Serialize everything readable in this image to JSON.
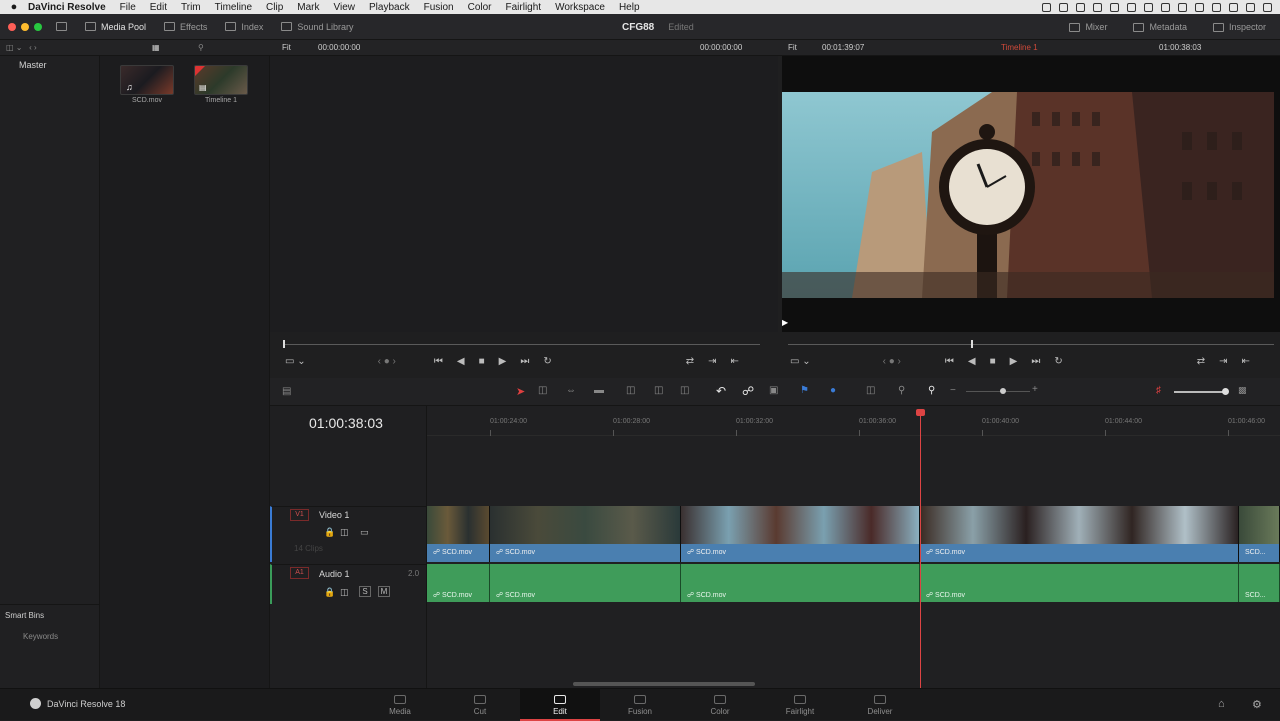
{
  "menubar": {
    "apple": "",
    "app": "DaVinci Resolve",
    "items": [
      "File",
      "Edit",
      "Trim",
      "Timeline",
      "Clip",
      "Mark",
      "View",
      "Playback",
      "Fusion",
      "Color",
      "Fairlight",
      "Workspace",
      "Help"
    ]
  },
  "toolbar": {
    "media_pool": "Media Pool",
    "effects": "Effects",
    "index": "Index",
    "sound_library": "Sound Library",
    "project": "CFG88",
    "edited": "Edited",
    "mixer": "Mixer",
    "metadata": "Metadata",
    "inspector": "Inspector"
  },
  "source_bar": {
    "fit": "Fit",
    "tc_left": "00:00:00:00",
    "tc_right": "00:00:00:00"
  },
  "program_bar": {
    "fit": "Fit",
    "duration": "00:01:39:07",
    "timeline_name": "Timeline 1",
    "timecode": "01:00:38:03"
  },
  "bins": {
    "master": "Master",
    "smart_bins": "Smart Bins",
    "keywords": "Keywords"
  },
  "pool_clips": [
    {
      "label": "SCD.mov"
    },
    {
      "label": "Timeline 1"
    }
  ],
  "timeline": {
    "timecode": "01:00:38:03",
    "ruler": [
      "01:00:24:00",
      "01:00:28:00",
      "01:00:32:00",
      "01:00:36:00",
      "01:00:40:00",
      "01:00:44:00",
      "01:00:46:00"
    ],
    "video_track": {
      "badge": "V1",
      "name": "Video 1",
      "clips_count": "14 Clips"
    },
    "audio_track": {
      "badge": "A1",
      "name": "Audio 1",
      "channels": "2.0",
      "solo": "S",
      "mute": "M"
    },
    "clip_label": "SCD.mov",
    "clip_label_short": "SCD..."
  },
  "pages": [
    "Media",
    "Cut",
    "Edit",
    "Fusion",
    "Color",
    "Fairlight",
    "Deliver"
  ],
  "brand": "DaVinci Resolve 18"
}
